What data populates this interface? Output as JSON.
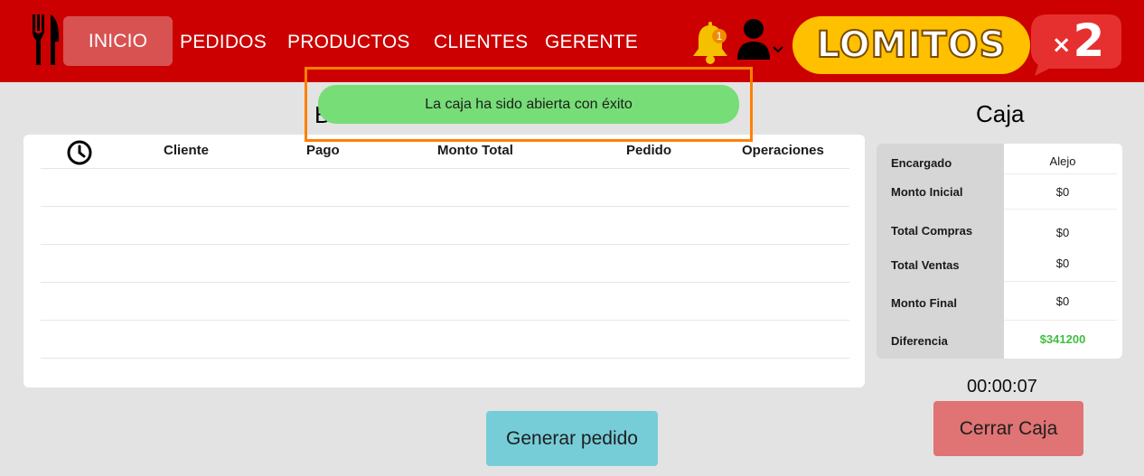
{
  "header": {
    "logo_icon": "fork-knife-icon",
    "nav": [
      {
        "label": "INICIO",
        "active": true
      },
      {
        "label": "PEDIDOS"
      },
      {
        "label": "PRODUCTOS"
      },
      {
        "label": "CLIENTES"
      },
      {
        "label": "GERENTE"
      }
    ],
    "notification_count": "1",
    "brand_name": "LOMITOS",
    "brand_badge_x": "×",
    "brand_badge_n": "2",
    "colors": {
      "bar": "#cc0000",
      "brand": "#ffc000",
      "badge": "#e63030"
    }
  },
  "toast": {
    "message": "La caja ha sido abierta con éxito",
    "color": "#77dd77"
  },
  "main": {
    "title_visible": "B",
    "table": {
      "columns": [
        "Cliente",
        "Pago",
        "Monto Total",
        "Pedido",
        "Operaciones"
      ],
      "time_icon": "clock-icon",
      "rows": []
    },
    "generate_button": "Generar pedido"
  },
  "caja": {
    "title": "Caja",
    "rows": [
      {
        "label": "Encargado",
        "value": "Alejo"
      },
      {
        "label": "Monto Inicial",
        "value": "$0"
      },
      {
        "label": "Total Compras",
        "value": "$0"
      },
      {
        "label": "Total Ventas",
        "value": "$0"
      },
      {
        "label": "Monto Final",
        "value": "$0"
      },
      {
        "label": "Diferencia",
        "value": "$341200"
      }
    ],
    "timer": "00:00:07",
    "close_button": "Cerrar Caja"
  }
}
